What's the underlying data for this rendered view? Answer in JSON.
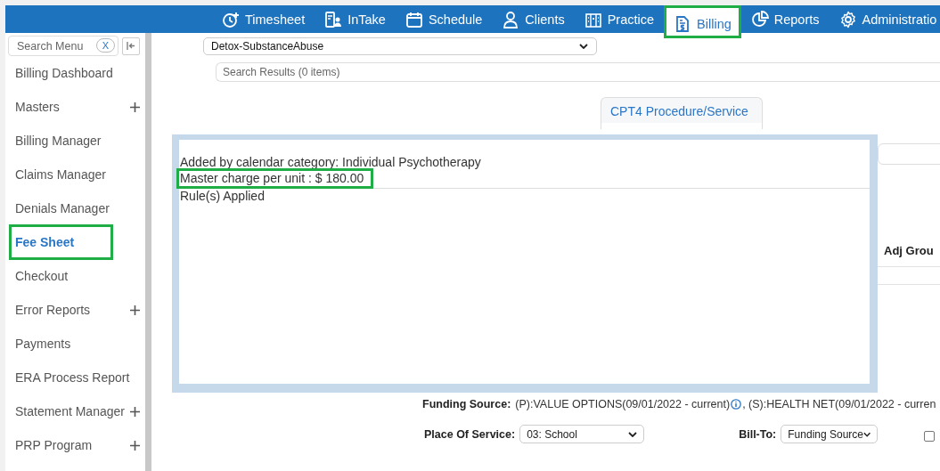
{
  "nav": {
    "items": [
      {
        "label": "Timesheet",
        "selected": false,
        "highlighted": false
      },
      {
        "label": "InTake",
        "selected": false,
        "highlighted": false
      },
      {
        "label": "Schedule",
        "selected": false,
        "highlighted": false
      },
      {
        "label": "Clients",
        "selected": false,
        "highlighted": false
      },
      {
        "label": "Practice",
        "selected": false,
        "highlighted": false
      },
      {
        "label": "Billing",
        "selected": true,
        "highlighted": true
      },
      {
        "label": "Reports",
        "selected": false,
        "highlighted": false
      },
      {
        "label": "Administratio",
        "selected": false,
        "highlighted": false
      }
    ]
  },
  "sidebar": {
    "search": {
      "placeholder": "Search Menu"
    },
    "clear_button": "X",
    "items": [
      {
        "label": "Billing Dashboard",
        "expandable": false,
        "selected": false,
        "highlighted": false
      },
      {
        "label": "Masters",
        "expandable": true,
        "selected": false,
        "highlighted": false
      },
      {
        "label": "Billing Manager",
        "expandable": false,
        "selected": false,
        "highlighted": false
      },
      {
        "label": "Claims Manager",
        "expandable": false,
        "selected": false,
        "highlighted": false
      },
      {
        "label": "Denials Manager",
        "expandable": false,
        "selected": false,
        "highlighted": false
      },
      {
        "label": "Fee Sheet",
        "expandable": false,
        "selected": true,
        "highlighted": true
      },
      {
        "label": "Checkout",
        "expandable": false,
        "selected": false,
        "highlighted": false
      },
      {
        "label": "Error Reports",
        "expandable": true,
        "selected": false,
        "highlighted": false
      },
      {
        "label": "Payments",
        "expandable": false,
        "selected": false,
        "highlighted": false
      },
      {
        "label": "ERA Process Report",
        "expandable": false,
        "selected": false,
        "highlighted": false
      },
      {
        "label": "Statement Manager",
        "expandable": true,
        "selected": false,
        "highlighted": false
      },
      {
        "label": "PRP Program",
        "expandable": true,
        "selected": false,
        "highlighted": false
      }
    ]
  },
  "main": {
    "program_select": "Detox-SubstanceAbuse",
    "search_results": {
      "placeholder": "Search Results (0 items)"
    },
    "tab": "CPT4 Procedure/Service",
    "adj_group_label": "Adj Grou",
    "popup": {
      "lines": [
        {
          "text": "Added by calendar category: Individual Psychotherapy",
          "highlighted": false
        },
        {
          "text": "Master charge per unit : $ 180.00",
          "highlighted": true
        },
        {
          "text": "Rule(s) Applied",
          "highlighted": false
        }
      ]
    },
    "funding": {
      "label": "Funding Source:",
      "primary": "(P):VALUE OPTIONS(09/01/2022 - current)",
      "secondary": ", (S):HEALTH NET(09/01/2022 - curren"
    },
    "place_of_service": {
      "label": "Place Of Service:",
      "value": "03: School"
    },
    "bill_to": {
      "label": "Bill-To:",
      "value": "Funding Source"
    },
    "checkbox": {
      "checked": false
    }
  }
}
